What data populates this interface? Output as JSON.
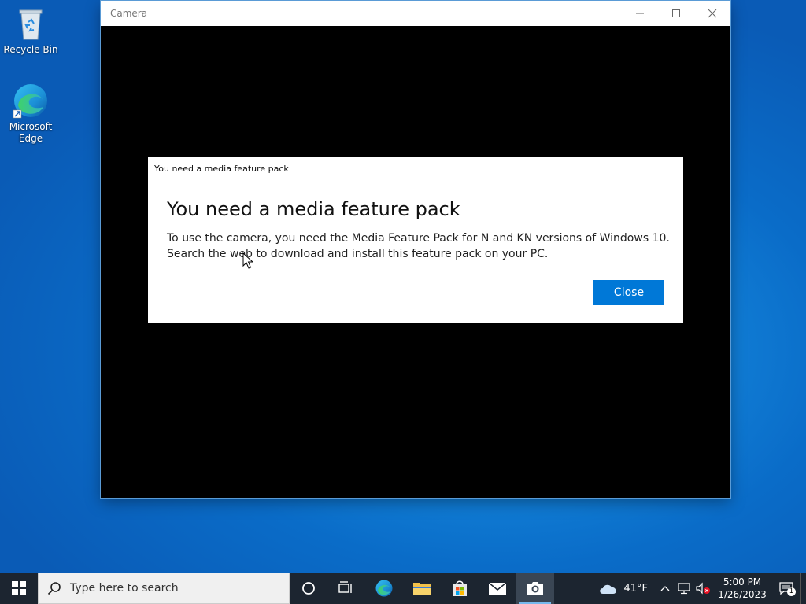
{
  "desktop": {
    "icons": [
      {
        "label": "Recycle Bin"
      },
      {
        "label": "Microsoft Edge"
      }
    ]
  },
  "window": {
    "title": "Camera"
  },
  "dialog": {
    "window_title": "You need a media feature pack",
    "heading": "You need a media feature pack",
    "body_line1": "To use the camera, you need the Media Feature Pack for N and KN versions of Windows 10.",
    "body_line2": "Search the web to download and install this feature pack on your PC.",
    "close_label": "Close"
  },
  "taskbar": {
    "search_placeholder": "Type here to search",
    "weather": "41°F",
    "time": "5:00 PM",
    "date": "1/26/2023",
    "notification_count": "1"
  },
  "colors": {
    "accent": "#0078d7",
    "taskbar": "#1c2530"
  }
}
